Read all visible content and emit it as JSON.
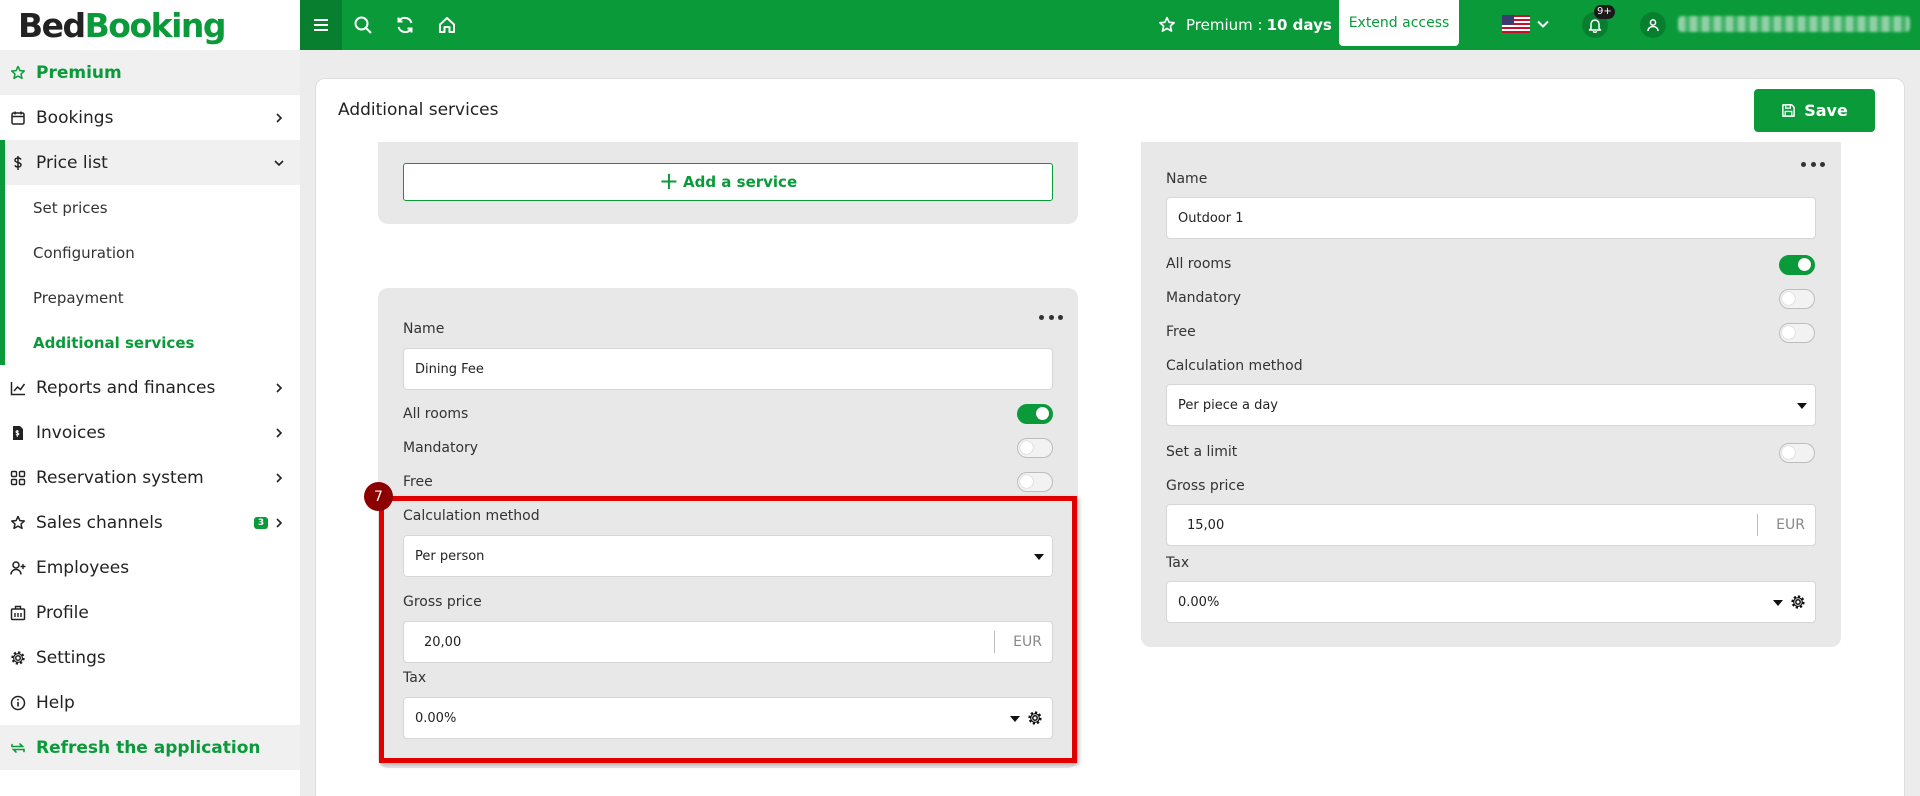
{
  "brand": {
    "part1": "Bed",
    "part2": "Booking"
  },
  "sidebar": {
    "premium": "Premium",
    "items": [
      {
        "label": "Bookings"
      },
      {
        "label": "Price list"
      },
      {
        "label": "Reports and finances"
      },
      {
        "label": "Invoices"
      },
      {
        "label": "Reservation system"
      },
      {
        "label": "Sales channels",
        "badge": "3"
      },
      {
        "label": "Employees"
      },
      {
        "label": "Profile"
      },
      {
        "label": "Settings"
      },
      {
        "label": "Help"
      }
    ],
    "subitems": [
      {
        "label": "Set prices"
      },
      {
        "label": "Configuration"
      },
      {
        "label": "Prepayment"
      },
      {
        "label": "Additional services"
      }
    ],
    "refresh": "Refresh the application"
  },
  "topbar": {
    "premium_label": "Premium :",
    "premium_days": "10 days",
    "extend": "Extend access",
    "notifications": "9+",
    "language_flag": "flag-us-icon"
  },
  "page": {
    "title": "Additional services",
    "save": "Save",
    "add_service": "Add a service"
  },
  "service_left": {
    "name_label": "Name",
    "name_value": "Dining Fee",
    "all_rooms_label": "All rooms",
    "all_rooms": true,
    "mandatory_label": "Mandatory",
    "mandatory": false,
    "free_label": "Free",
    "free": false,
    "calc_label": "Calculation method",
    "calc_value": "Per person",
    "gross_label": "Gross price",
    "gross_value": "20,00",
    "currency": "EUR",
    "tax_label": "Tax",
    "tax_value": "0.00%",
    "step_number": "7"
  },
  "service_right": {
    "name_label": "Name",
    "name_value": "Outdoor 1",
    "all_rooms_label": "All rooms",
    "all_rooms": true,
    "mandatory_label": "Mandatory",
    "mandatory": false,
    "free_label": "Free",
    "free": false,
    "calc_label": "Calculation method",
    "calc_value": "Per piece a day",
    "limit_label": "Set a limit",
    "limit": false,
    "gross_label": "Gross price",
    "gross_value": "15,00",
    "currency": "EUR",
    "tax_label": "Tax",
    "tax_value": "0.00%"
  },
  "colors": {
    "accent": "#0a9a3a",
    "accent_dark": "#087f2f",
    "highlight": "#e00000"
  }
}
